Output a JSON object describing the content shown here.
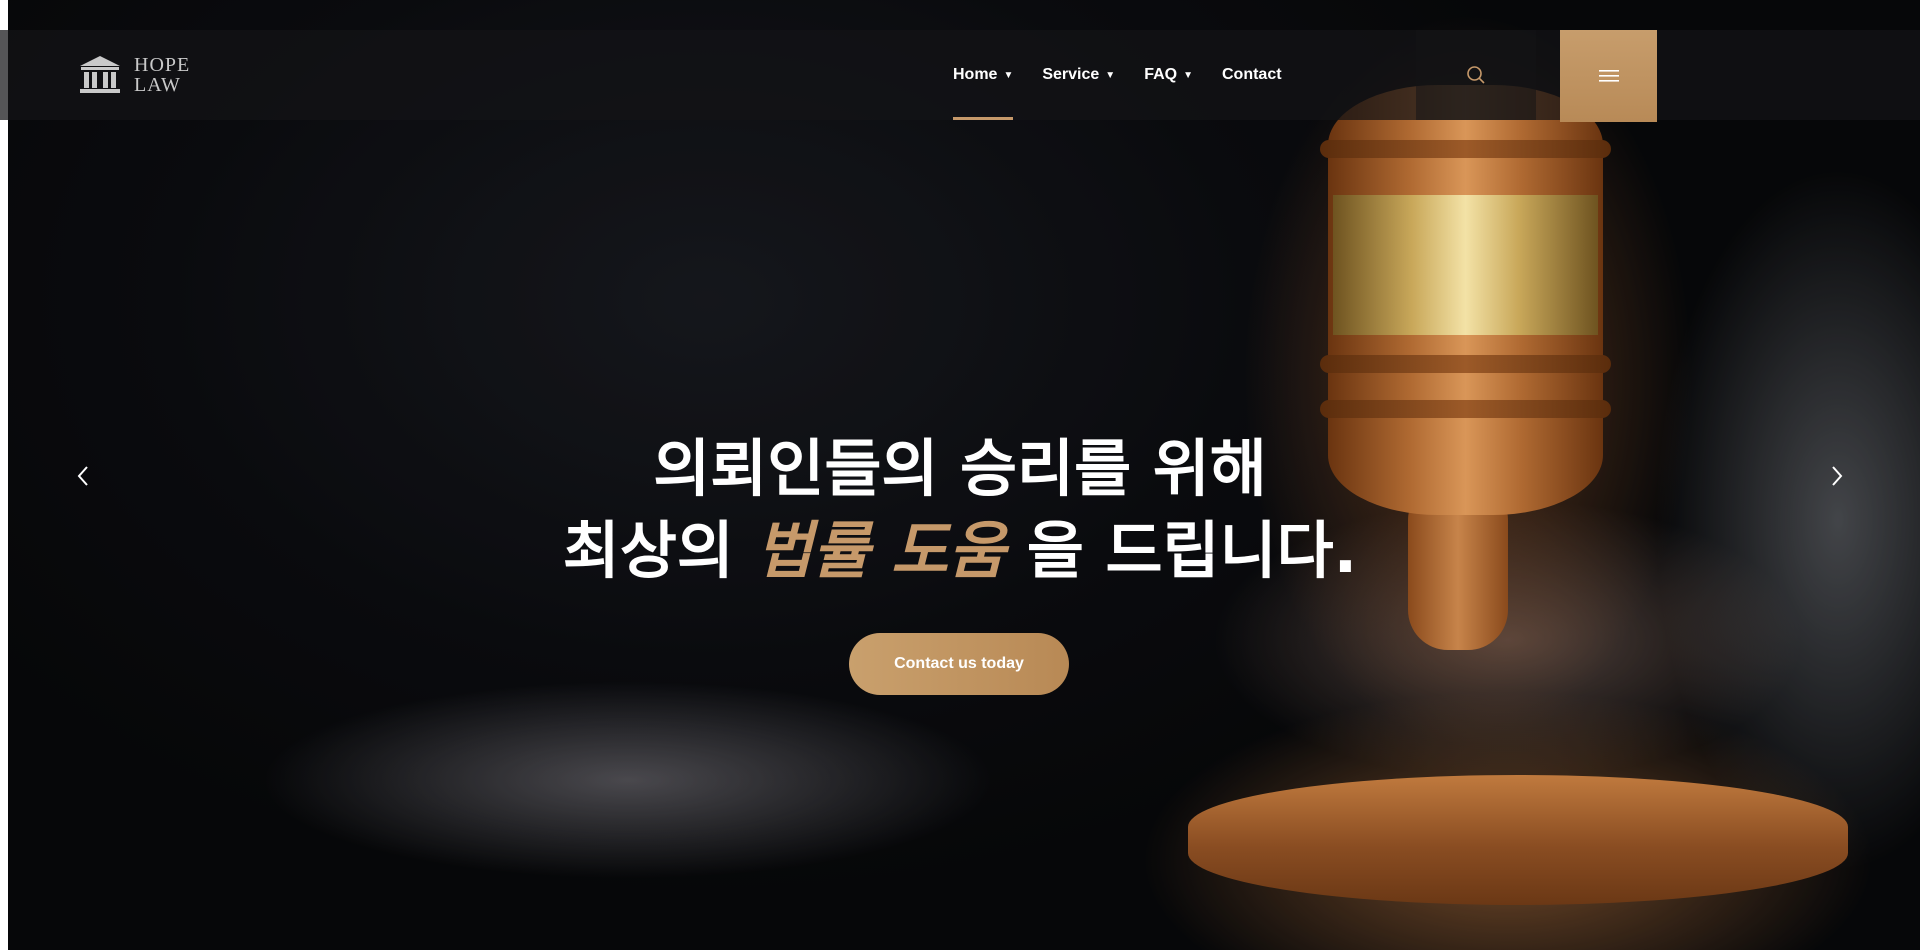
{
  "header": {
    "logo": {
      "line1": "HOPE",
      "line2": "LAW",
      "icon": "courthouse-icon"
    },
    "nav": [
      {
        "label": "Home",
        "has_dropdown": true,
        "active": true
      },
      {
        "label": "Service",
        "has_dropdown": true,
        "active": false
      },
      {
        "label": "FAQ",
        "has_dropdown": true,
        "active": false
      },
      {
        "label": "Contact",
        "has_dropdown": false,
        "active": false
      }
    ],
    "search_icon": "search-icon",
    "menu_icon": "hamburger-menu-icon"
  },
  "hero": {
    "headline_line1": "의뢰인들의 승리를 위해",
    "headline_line2_prefix": "최상의 ",
    "headline_line2_accent": "법률 도움",
    "headline_line2_suffix": "을 드립니다.",
    "cta_label": "Contact us today",
    "prev_icon": "chevron-left-icon",
    "next_icon": "chevron-right-icon"
  },
  "colors": {
    "accent": "#c6996a",
    "header_bg": "rgba(20,20,22,0.72)",
    "text": "#ffffff"
  }
}
